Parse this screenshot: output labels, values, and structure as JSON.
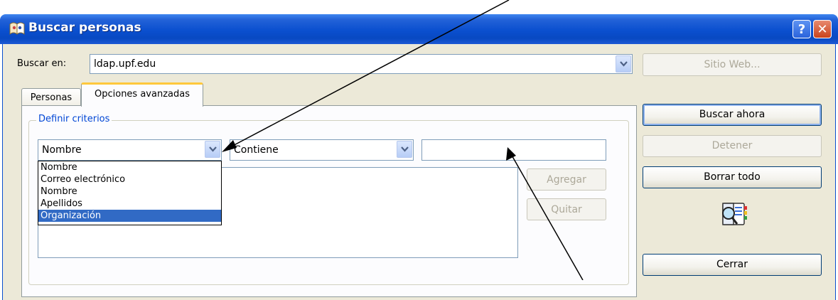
{
  "window": {
    "title": "Buscar personas",
    "help_button": "?",
    "close_button": "✕"
  },
  "search_in": {
    "label": "Buscar en:",
    "value": "ldap.upf.edu"
  },
  "website_button": "Sitio Web...",
  "tabs": [
    {
      "label": "Personas",
      "active": false
    },
    {
      "label": "Opciones avanzadas",
      "active": true
    }
  ],
  "criteria": {
    "group_title": "Definir criterios",
    "field_select": "Nombre",
    "condition_select": "Contiene",
    "value_input": "",
    "add_button": "Agregar",
    "remove_button": "Quitar"
  },
  "field_options": [
    {
      "label": "Nombre",
      "selected": false
    },
    {
      "label": "Correo electrónico",
      "selected": false
    },
    {
      "label": "Nombre",
      "selected": false
    },
    {
      "label": "Apellidos",
      "selected": false
    },
    {
      "label": "Organización",
      "selected": true
    }
  ],
  "side_buttons": {
    "search_now": "Buscar ahora",
    "stop": "Detener",
    "clear_all": "Borrar todo",
    "close": "Cerrar"
  },
  "icons": {
    "title_icon": "address-book-icon",
    "search_book_icon": "address-book-search-icon"
  },
  "colors": {
    "title_bar": "#0a4fcf",
    "dialog_face": "#ece9d8",
    "selection": "#316ac5",
    "group_title": "#0046d5"
  }
}
